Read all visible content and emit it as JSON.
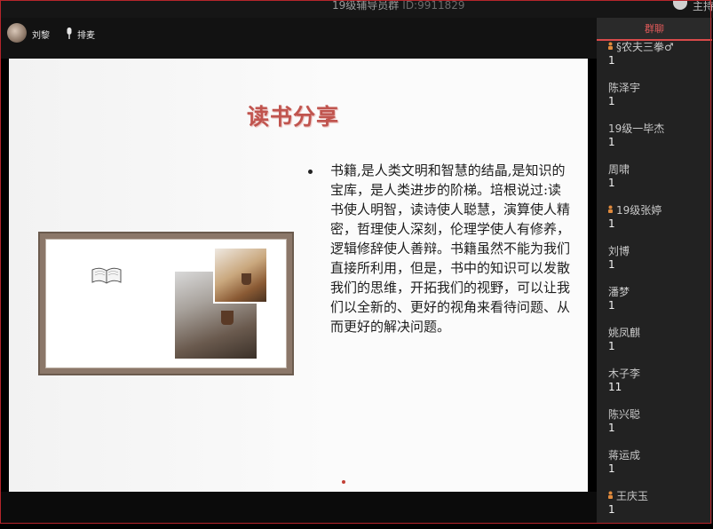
{
  "window": {
    "title": "19级辅导员群",
    "group_id": "ID:9911829",
    "host_name": "主持"
  },
  "topbar": {
    "user_name": "刘黎",
    "mic_label": "排麦"
  },
  "slide": {
    "title": "读书分享",
    "body": "书籍,是人类文明和智慧的结晶,是知识的宝库，是人类进步的阶梯。培根说过:读书使人明智，读诗使人聪慧，演算使人精密，哲理使人深刻，伦理学使人有修养，逻辑修辞使人善辩。书籍虽然不能为我们直接所利用，但是，书中的知识可以发散我们的思维，开拓我们的视野，可以让我们以全新的、更好的视角来看待问题、从而更好的解决问题。"
  },
  "side_panel": {
    "tab_label": "群聊",
    "members": [
      {
        "name": "§农夫三拳♂",
        "count": "1",
        "icon": true
      },
      {
        "name": "陈泽宇",
        "count": "1",
        "icon": false
      },
      {
        "name": "19级一毕杰",
        "count": "1",
        "icon": false
      },
      {
        "name": "周啸",
        "count": "1",
        "icon": false
      },
      {
        "name": "19级张婷",
        "count": "1",
        "icon": true
      },
      {
        "name": "刘博",
        "count": "1",
        "icon": false
      },
      {
        "name": "潘梦",
        "count": "1",
        "icon": false
      },
      {
        "name": "姚凤麒",
        "count": "1",
        "icon": false
      },
      {
        "name": "木子李",
        "count": "11",
        "icon": false
      },
      {
        "name": "陈兴聪",
        "count": "1",
        "icon": false
      },
      {
        "name": "蒋运成",
        "count": "1",
        "icon": false
      },
      {
        "name": "王庆玉",
        "count": "1",
        "icon": true
      }
    ]
  },
  "colors": {
    "accent_red": "#d84a4a",
    "title_red": "#c0544e",
    "panel_bg": "#222222"
  }
}
